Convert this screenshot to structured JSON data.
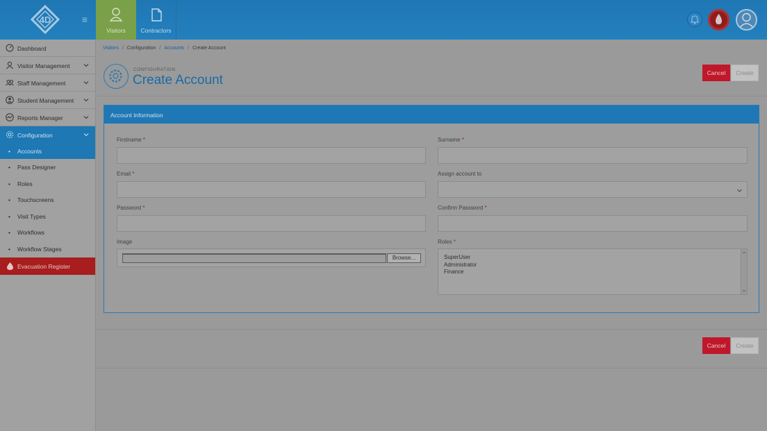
{
  "header": {
    "logo_text": "4D",
    "tabs": [
      {
        "label": "Visitors",
        "icon": "user-icon"
      },
      {
        "label": "Contractors",
        "icon": "document-icon"
      }
    ]
  },
  "sidebar": {
    "items": [
      {
        "label": "Dashboard",
        "icon": "dashboard-icon"
      },
      {
        "label": "Visitor Management",
        "icon": "user-icon"
      },
      {
        "label": "Staff Management",
        "icon": "group-icon"
      },
      {
        "label": "Student Management",
        "icon": "student-icon"
      },
      {
        "label": "Reports Manager",
        "icon": "reports-icon"
      },
      {
        "label": "Configuration",
        "icon": "gear-icon"
      }
    ],
    "sub_items": [
      "Accounts",
      "Pass Designer",
      "Roles",
      "Touchscreens",
      "Visit Types",
      "Workflows",
      "Workflow Stages"
    ],
    "evacuation": "Evacuation Register"
  },
  "breadcrumb": [
    "Visitors",
    "Configuration",
    "Accounts",
    "Create Account"
  ],
  "page": {
    "eyebrow": "CONFIGURATION",
    "title": "Create Account",
    "cancel_label": "Cancel",
    "create_label": "Create"
  },
  "form": {
    "panel_title": "Account Information",
    "firstname_label": "Firstname",
    "surname_label": "Surname",
    "email_label": "Email",
    "assign_label": "Assign account to",
    "password_label": "Password",
    "confirm_label": "Confirm Password",
    "image_label": "Image",
    "roles_label": "Roles",
    "required_mark": "*",
    "browse_label": "Browse...",
    "roles": [
      "SuperUser",
      "Administrator",
      "Finance"
    ]
  }
}
